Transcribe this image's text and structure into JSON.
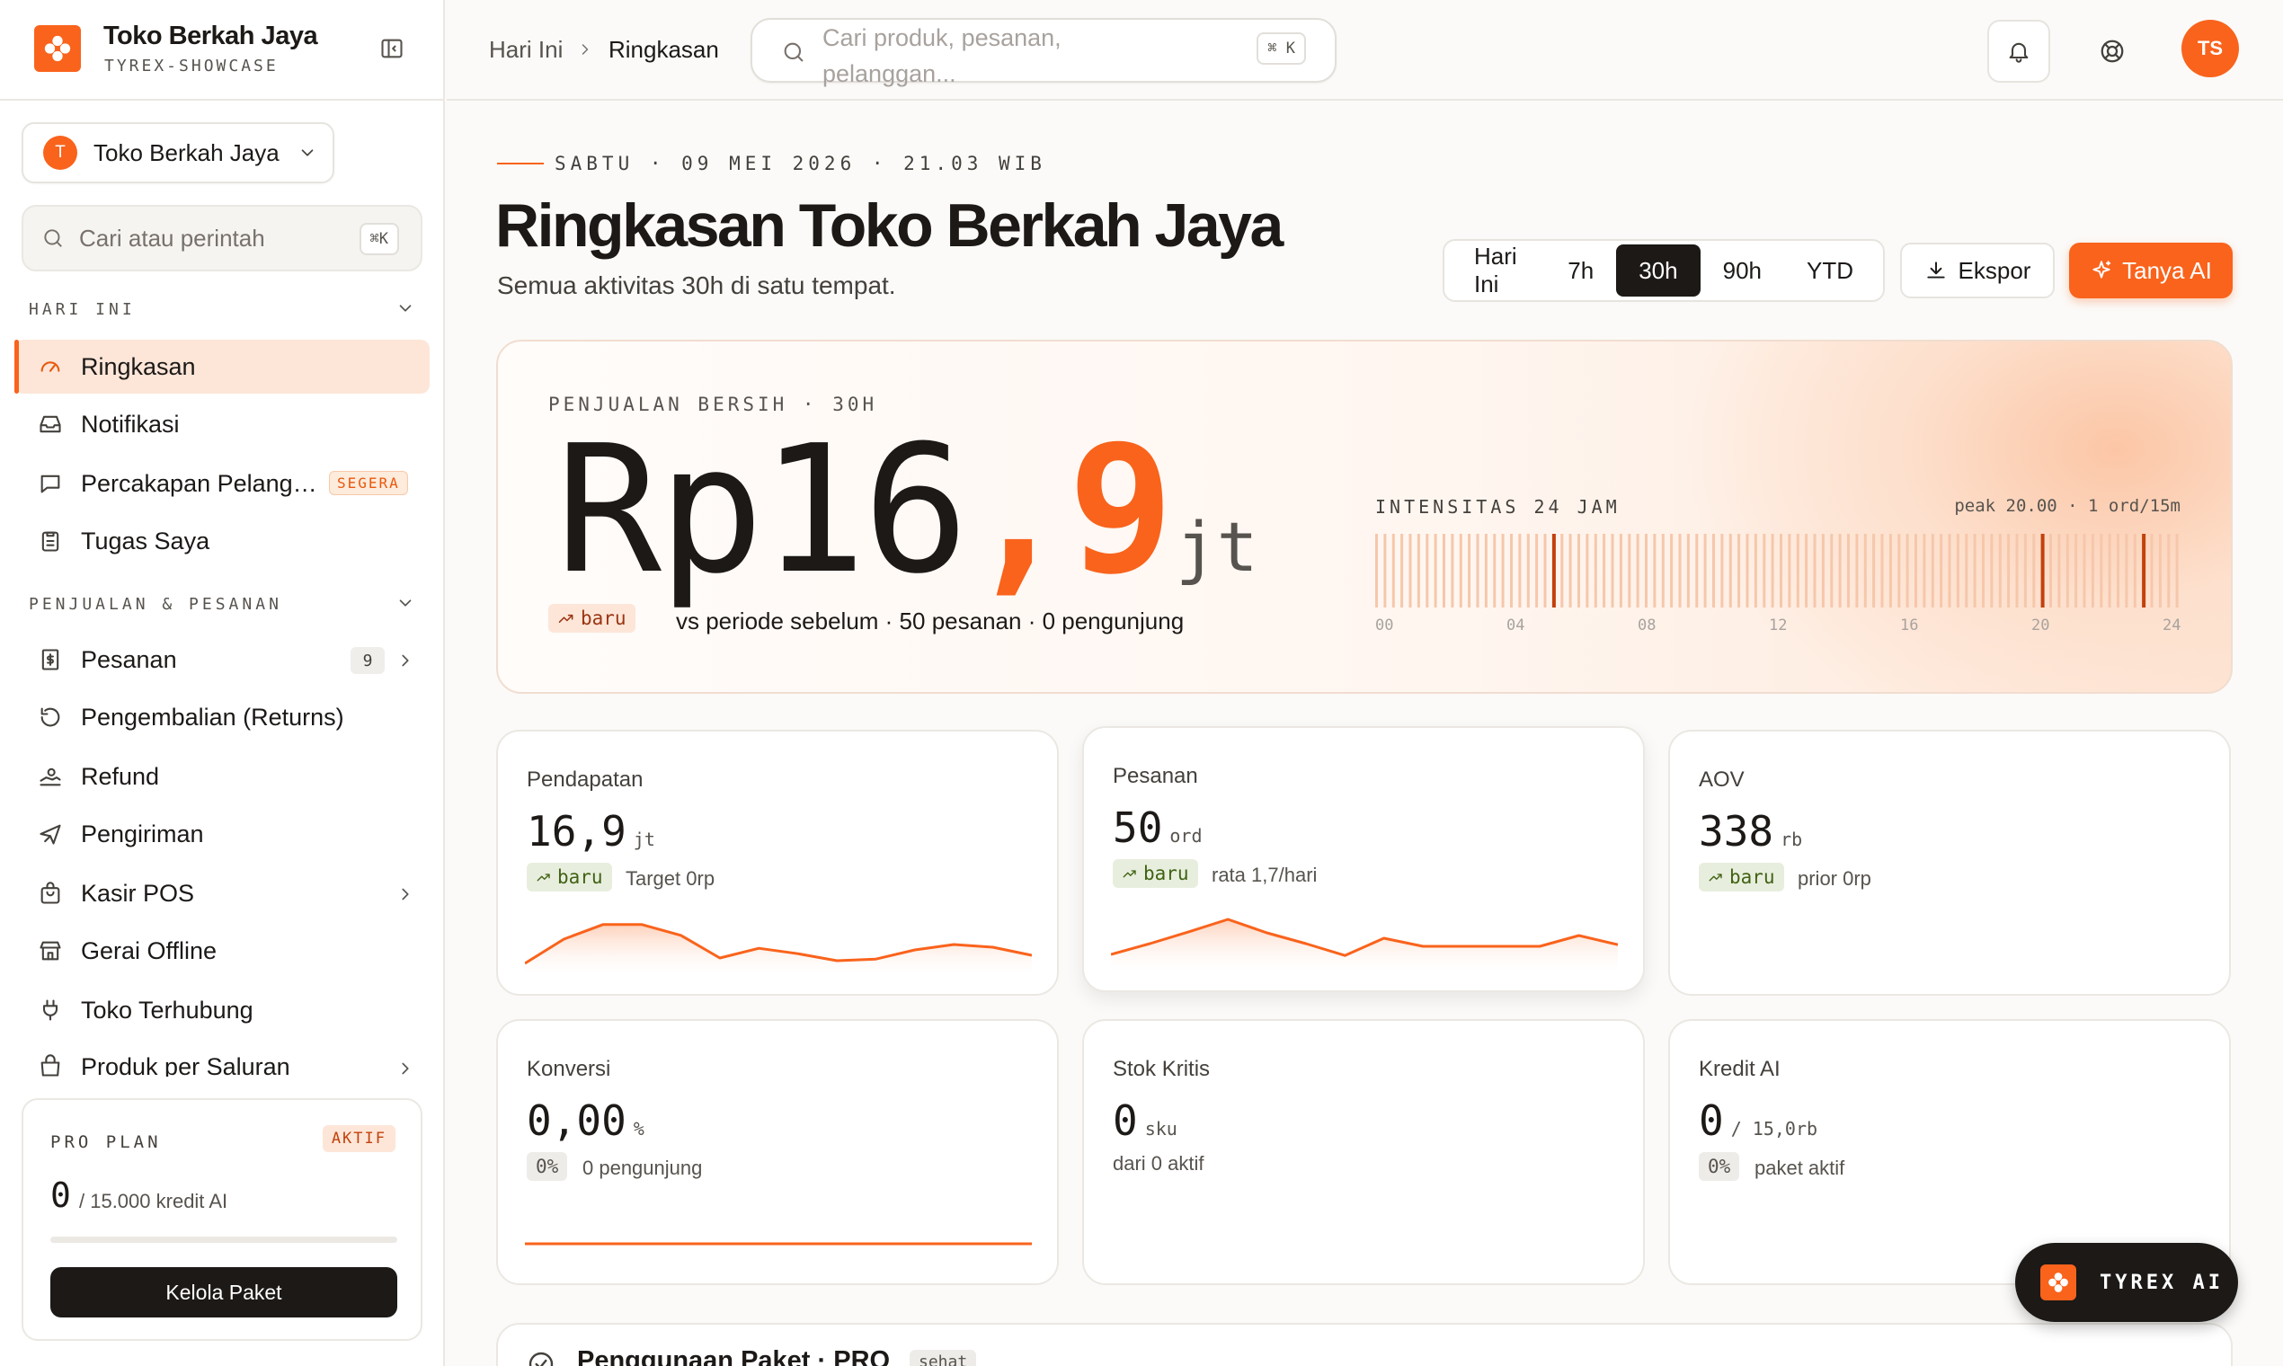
{
  "brand": {
    "name": "Toko Berkah Jaya",
    "subtitle": "TYREX-SHOWCASE",
    "accent": "#f9631c"
  },
  "sidebar": {
    "store_selector": {
      "avatar_letter": "T",
      "name": "Toko Berkah Jaya"
    },
    "search": {
      "placeholder": "Cari atau perintah",
      "shortcut": "⌘K"
    },
    "sections": [
      {
        "label": "HARI INI",
        "items": [
          {
            "label": "Ringkasan",
            "icon": "gauge-icon",
            "active": true
          },
          {
            "label": "Notifikasi",
            "icon": "inbox-icon"
          },
          {
            "label": "Percakapan Pelang…",
            "icon": "message-icon",
            "badge": "SEGERA"
          },
          {
            "label": "Tugas Saya",
            "icon": "clipboard-icon"
          }
        ]
      },
      {
        "label": "PENJUALAN & PESANAN",
        "items": [
          {
            "label": "Pesanan",
            "icon": "receipt-icon",
            "count": "9"
          },
          {
            "label": "Pengembalian (Returns)",
            "icon": "undo-icon"
          },
          {
            "label": "Refund",
            "icon": "refund-icon"
          },
          {
            "label": "Pengiriman",
            "icon": "plane-icon"
          },
          {
            "label": "Kasir POS",
            "icon": "bag-icon"
          },
          {
            "label": "Gerai Offline",
            "icon": "store-icon"
          },
          {
            "label": "Toko Terhubung",
            "icon": "plug-icon"
          },
          {
            "label": "Produk per Saluran",
            "icon": "shop-icon"
          }
        ]
      }
    ],
    "plan": {
      "title": "PRO PLAN",
      "status": "AKTIF",
      "used": "0",
      "limit_label": "/ 15.000 kredit AI",
      "used_fraction": 0,
      "button": "Kelola Paket"
    }
  },
  "topbar": {
    "breadcrumb": [
      "Hari Ini",
      "Ringkasan"
    ],
    "search": {
      "placeholder": "Cari produk, pesanan, pelanggan...",
      "shortcut": "⌘ K"
    },
    "user_initials": "TS"
  },
  "header": {
    "dateline": "SABTU · 09 MEI 2026 · 21.03 WIB",
    "title": "Ringkasan Toko Berkah Jaya",
    "subtitle": "Semua aktivitas 30h di satu tempat.",
    "ranges": [
      "Hari Ini",
      "7h",
      "30h",
      "90h",
      "YTD"
    ],
    "selected_range": "30h",
    "export_label": "Ekspor",
    "ai_label": "Tanya AI"
  },
  "hero": {
    "title": "PENJUALAN BERSIH · 30H",
    "value_main": "Rp16",
    "value_decimal": ",9",
    "value_unit": "jt",
    "trend": "baru",
    "comparison": "vs periode sebelum · 50 pesanan · 0 pengunjung",
    "intensity": {
      "title": "INTENSITAS 24 JAM",
      "peak": "peak 20.00 · 1 ord/15m",
      "ticks": [
        "00",
        "04",
        "08",
        "12",
        "16",
        "20",
        "24"
      ],
      "slots": 96,
      "highlight_slots": [
        21,
        79,
        91
      ]
    }
  },
  "kpis": [
    {
      "label": "Pendapatan",
      "value": "16,9",
      "unit": "jt",
      "pill": "baru",
      "pill_style": "trend",
      "sub": "Target 0rp",
      "spark": [
        0.1,
        0.55,
        0.82,
        0.82,
        0.62,
        0.2,
        0.38,
        0.28,
        0.15,
        0.18,
        0.35,
        0.45,
        0.4,
        0.25
      ],
      "spark_fill": true
    },
    {
      "label": "Pesanan",
      "value": "50",
      "unit": "ord",
      "pill": "baru",
      "pill_style": "trend",
      "sub": "rata 1,7/hari",
      "spark": [
        0.2,
        0.4,
        0.62,
        0.85,
        0.6,
        0.4,
        0.18,
        0.5,
        0.35,
        0.35,
        0.35,
        0.35,
        0.55,
        0.38
      ],
      "spark_fill": true
    },
    {
      "label": "AOV",
      "value": "338",
      "unit": "rb",
      "pill": "baru",
      "pill_style": "trend",
      "sub": "prior 0rp"
    },
    {
      "label": "Konversi",
      "value": "0,00",
      "unit": "%",
      "pill": "0%",
      "pill_style": "grey",
      "sub": "0 pengunjung",
      "flatline": true
    },
    {
      "label": "Stok Kritis",
      "value": "0",
      "unit": "sku",
      "sub": "dari 0 aktif"
    },
    {
      "label": "Kredit AI",
      "value": "0",
      "unit": "/ 15,0rb",
      "pill": "0%",
      "pill_style": "grey",
      "sub": "paket aktif"
    }
  ],
  "peek": {
    "title": "Penggunaan Paket · PRO",
    "badge": "sehat"
  },
  "fab": {
    "label": "TYREX AI"
  }
}
